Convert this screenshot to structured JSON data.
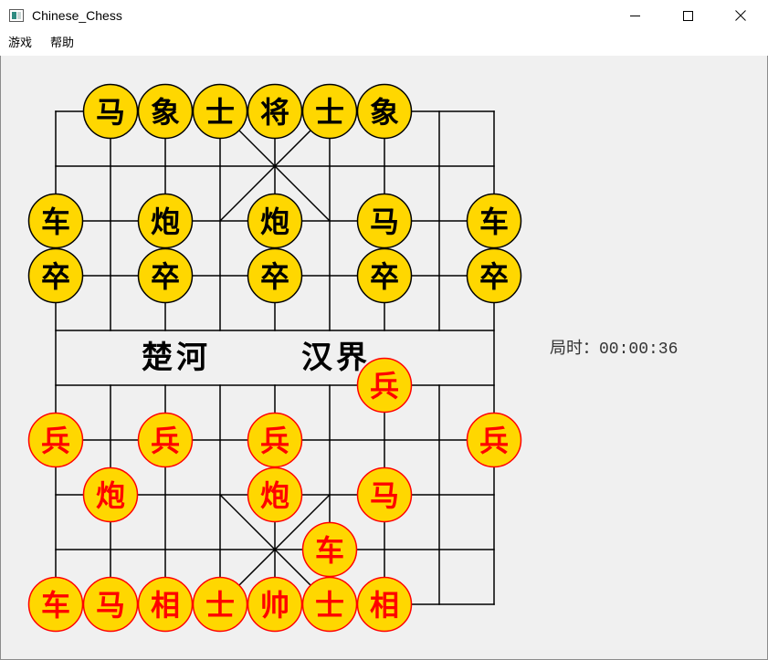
{
  "window": {
    "title": "Chinese_Chess",
    "app_icon": "app-window-icon",
    "controls": {
      "minimize_icon": "minimize-icon",
      "maximize_icon": "maximize-icon",
      "close_icon": "close-icon"
    }
  },
  "menu": {
    "items": [
      "游戏",
      "帮助"
    ]
  },
  "board": {
    "river": {
      "left": "楚河",
      "right": "汉界"
    }
  },
  "pieces": {
    "black": [
      {
        "char": "马",
        "file": 1,
        "rank": 0
      },
      {
        "char": "象",
        "file": 2,
        "rank": 0
      },
      {
        "char": "士",
        "file": 3,
        "rank": 0
      },
      {
        "char": "将",
        "file": 4,
        "rank": 0
      },
      {
        "char": "士",
        "file": 5,
        "rank": 0
      },
      {
        "char": "象",
        "file": 6,
        "rank": 0
      },
      {
        "char": "车",
        "file": 0,
        "rank": 2
      },
      {
        "char": "炮",
        "file": 2,
        "rank": 2
      },
      {
        "char": "炮",
        "file": 4,
        "rank": 2
      },
      {
        "char": "马",
        "file": 6,
        "rank": 2
      },
      {
        "char": "车",
        "file": 8,
        "rank": 2
      },
      {
        "char": "卒",
        "file": 0,
        "rank": 3
      },
      {
        "char": "卒",
        "file": 2,
        "rank": 3
      },
      {
        "char": "卒",
        "file": 4,
        "rank": 3
      },
      {
        "char": "卒",
        "file": 6,
        "rank": 3
      },
      {
        "char": "卒",
        "file": 8,
        "rank": 3
      }
    ],
    "red": [
      {
        "char": "兵",
        "file": 6,
        "rank": 5
      },
      {
        "char": "兵",
        "file": 0,
        "rank": 6
      },
      {
        "char": "兵",
        "file": 2,
        "rank": 6
      },
      {
        "char": "兵",
        "file": 4,
        "rank": 6
      },
      {
        "char": "兵",
        "file": 8,
        "rank": 6
      },
      {
        "char": "炮",
        "file": 1,
        "rank": 7
      },
      {
        "char": "炮",
        "file": 4,
        "rank": 7
      },
      {
        "char": "马",
        "file": 6,
        "rank": 7
      },
      {
        "char": "车",
        "file": 5,
        "rank": 8
      },
      {
        "char": "车",
        "file": 0,
        "rank": 9
      },
      {
        "char": "马",
        "file": 1,
        "rank": 9
      },
      {
        "char": "相",
        "file": 2,
        "rank": 9
      },
      {
        "char": "士",
        "file": 3,
        "rank": 9
      },
      {
        "char": "帅",
        "file": 4,
        "rank": 9
      },
      {
        "char": "士",
        "file": 5,
        "rank": 9
      },
      {
        "char": "相",
        "file": 6,
        "rank": 9
      }
    ]
  },
  "timer": {
    "label": "局时：",
    "value": "00:00:36"
  },
  "colors": {
    "background": "#f0f0f0",
    "board_line": "#000000",
    "piece_fill": "#ffd700",
    "black_side": "#000000",
    "red_side": "#ff0000",
    "timer_text": "#333333"
  }
}
